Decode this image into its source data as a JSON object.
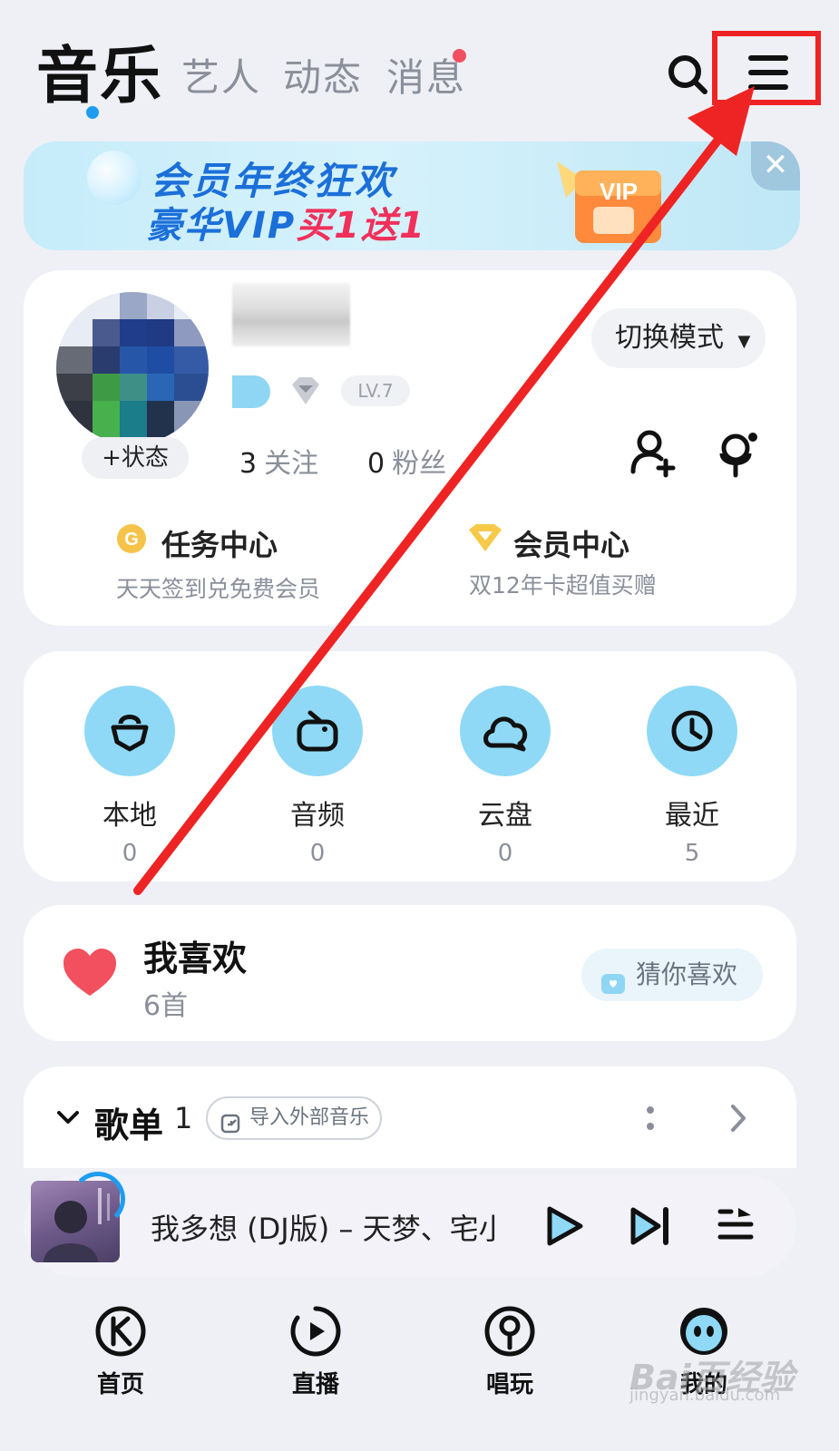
{
  "header": {
    "tabs": [
      {
        "label": "音乐",
        "active": true
      },
      {
        "label": "艺人"
      },
      {
        "label": "动态"
      },
      {
        "label": "消息",
        "has_dot": true
      }
    ],
    "icons": [
      "search-icon",
      "menu-icon"
    ]
  },
  "banner": {
    "line1": "会员年终狂欢",
    "line2_a": "豪华VIP",
    "line2_b": "买1送1",
    "gift_text": "VIP",
    "close_symbol": "✕"
  },
  "profile": {
    "status_label": "+状态",
    "level": "LV.7",
    "switch_mode_label": "切换模式",
    "following_count": "3",
    "following_label": "关注",
    "fans_count": "0",
    "fans_label": "粉丝",
    "task_center": {
      "title": "任务中心",
      "subtitle": "天天签到兑免费会员",
      "icon_letter": "G"
    },
    "vip_center": {
      "title": "会员中心",
      "subtitle": "双12年卡超值买赠"
    }
  },
  "quick_entries": [
    {
      "label": "本地",
      "count": "0",
      "icon": "local-music-icon"
    },
    {
      "label": "音频",
      "count": "0",
      "icon": "radio-icon"
    },
    {
      "label": "云盘",
      "count": "0",
      "icon": "cloud-icon"
    },
    {
      "label": "最近",
      "count": "5",
      "icon": "clock-icon"
    }
  ],
  "favorites": {
    "title": "我喜欢",
    "subtitle": "6首",
    "guess_label": "猜你喜欢"
  },
  "playlist": {
    "title": "歌单",
    "count": "1",
    "import_label": "导入外部音乐"
  },
  "player": {
    "song": "我多想 (DJ版) – 天梦、宅小"
  },
  "bottom_nav": [
    {
      "label": "首页",
      "icon": "home-k-icon"
    },
    {
      "label": "直播",
      "icon": "live-play-icon"
    },
    {
      "label": "唱玩",
      "icon": "mic-icon"
    },
    {
      "label": "我的",
      "icon": "profile-avatar-icon"
    }
  ],
  "watermark": {
    "main": "Bai百经验",
    "sub": "jingyan.baidu.com"
  },
  "colors": {
    "accent": "#1e9df0",
    "highlight_red": "#ee2424",
    "entry_circle": "#8fd9f6",
    "heart": "#f2505e"
  }
}
